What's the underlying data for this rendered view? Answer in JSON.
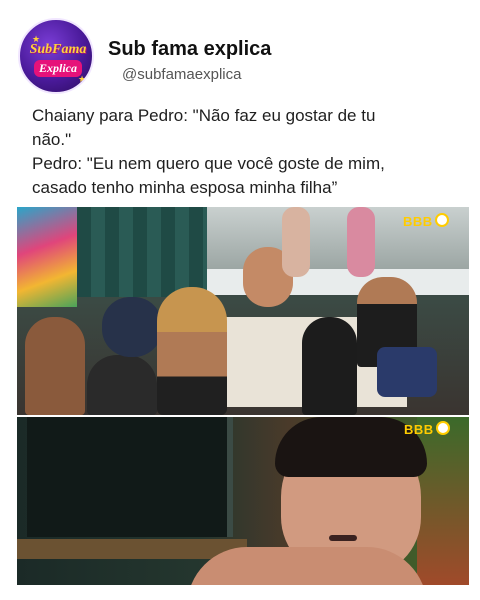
{
  "header": {
    "avatar_text_line1": "SubFama",
    "avatar_text_line2": "Explica",
    "account_name": "Sub fama explica",
    "handle": "@subfamaexplica"
  },
  "post": {
    "lines": [
      "Chaiany para Pedro: \"Não faz eu gostar de tu",
      "não.\"",
      "Pedro: \"Eu nem quero que você goste de mim,",
      "casado tenho minha esposa minha filha”"
    ]
  },
  "media": {
    "logo_top": "BBB",
    "logo_bottom": "BBB"
  },
  "colors": {
    "accent_logo": "#ffcc00",
    "avatar_purple": "#4a1a9a",
    "avatar_pink": "#e6127a"
  }
}
